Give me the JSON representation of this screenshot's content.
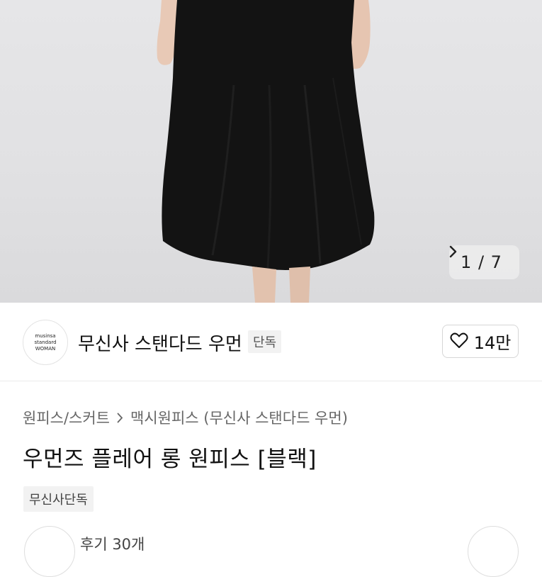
{
  "gallery": {
    "counter": "1 / 7",
    "next_icon": "chevron-right-icon"
  },
  "brand": {
    "logo_line1": "musinsa",
    "logo_line2": "standard",
    "logo_line3": "WOMAN",
    "name": "무신사 스탠다드 우먼",
    "badge": "단독",
    "like_icon": "heart-outline-icon",
    "like_count": "14만"
  },
  "product": {
    "breadcrumb": [
      "원피스/스커트",
      "맥시원피스 (무신사 스탠다드 우먼)"
    ],
    "title": "우먼즈 플레어 롱 원피스 [블랙]",
    "exclusive_badge": "무신사단독"
  },
  "bottom": {
    "review_text": "후기 30개"
  },
  "colors": {
    "accent": "#111111",
    "badge_bg": "#f2f2f2",
    "hero_bg": "#e3e3e5",
    "dress": "#121212"
  }
}
